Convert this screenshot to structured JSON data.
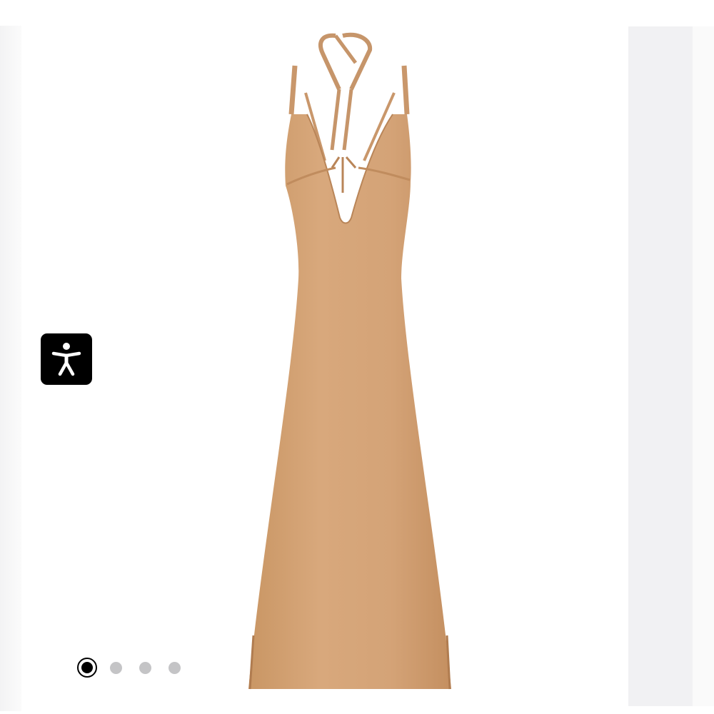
{
  "colors": {
    "dress": "#d6a579",
    "dress_shadow": "#c89567",
    "accessibility_bg": "#000000",
    "dot_inactive": "#c4c4c6",
    "side_panel": "#f1f1f3"
  },
  "icons": {
    "accessibility": "accessibility-person-icon"
  },
  "carousel": {
    "slide_count": 4,
    "active_index": 0
  }
}
